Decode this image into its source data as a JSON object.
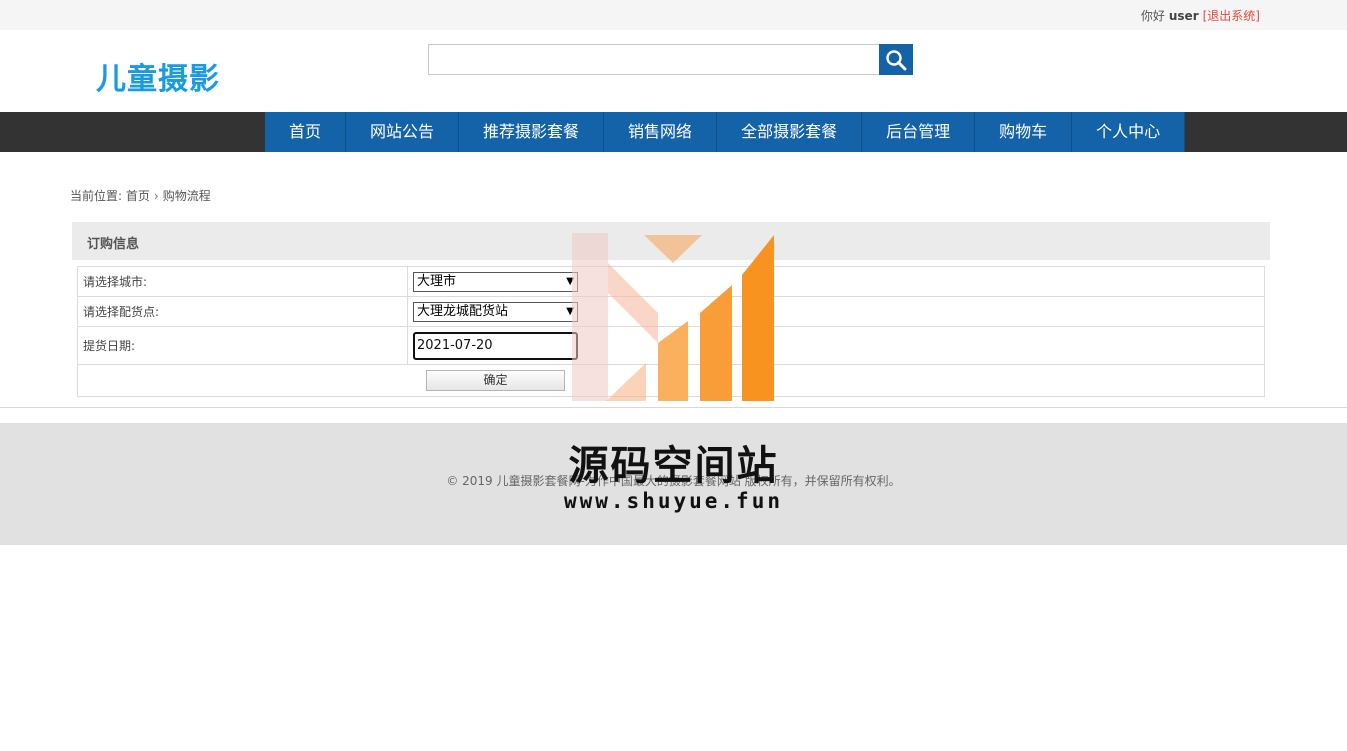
{
  "topbar": {
    "greeting": "你好",
    "username": "user",
    "logout": "[退出系统]"
  },
  "header": {
    "logo": "儿童摄影",
    "search": {
      "value": "",
      "placeholder": ""
    }
  },
  "nav": {
    "items": [
      "首页",
      "网站公告",
      "推荐摄影套餐",
      "销售网络",
      "全部摄影套餐",
      "后台管理",
      "购物车",
      "个人中心"
    ]
  },
  "breadcrumb": {
    "prefix": "当前位置:",
    "home": "首页",
    "separator": "›",
    "current": "购物流程"
  },
  "order": {
    "title": "订购信息",
    "city_label": "请选择城市:",
    "city_value": "大理市",
    "station_label": "请选择配货点:",
    "station_value": "大理龙城配货站",
    "date_label": "提货日期:",
    "date_value": "2021-07-20",
    "confirm": "确定"
  },
  "footer": {
    "copyright": "© 2019 儿童摄影套餐网-力作中国最大的摄影套餐网站 版权所有，并保留所有权利。"
  },
  "watermark": {
    "title": "源码空间站",
    "url": "www.shuyue.fun"
  },
  "colors": {
    "brand_blue": "#1463a8",
    "logo_blue": "#1a9be0",
    "nav_dark": "#333333",
    "logout_red": "#e74c3c",
    "watermark_orange": "#f7931e"
  }
}
